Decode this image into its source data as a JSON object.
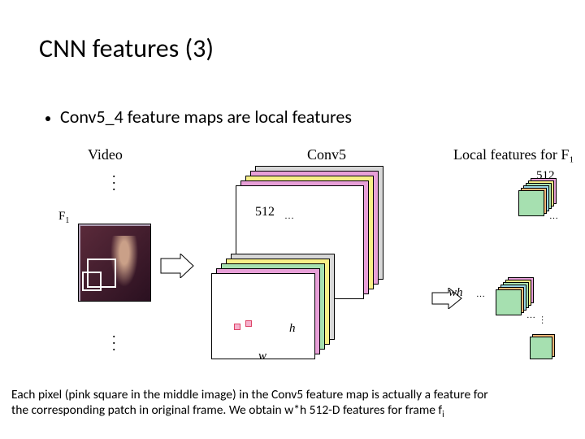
{
  "title": "CNN features (3)",
  "bullet": "Conv5_4 feature maps are local features",
  "labels": {
    "video": "Video",
    "conv5": "Conv5",
    "local": "Local features for F₁",
    "f1": "F",
    "f1_sub": "1",
    "n512": "512",
    "ellipsis": "…",
    "h": "h",
    "w": "w",
    "wh": "wh",
    "n512b": "512"
  },
  "footer_a": "Each pixel (pink square in the middle image) in the Conv5 feature map is actually a feature for",
  "footer_b": "the corresponding patch in original frame. We obtain w*h 512-D features for frame f",
  "footer_b_sub": "i"
}
